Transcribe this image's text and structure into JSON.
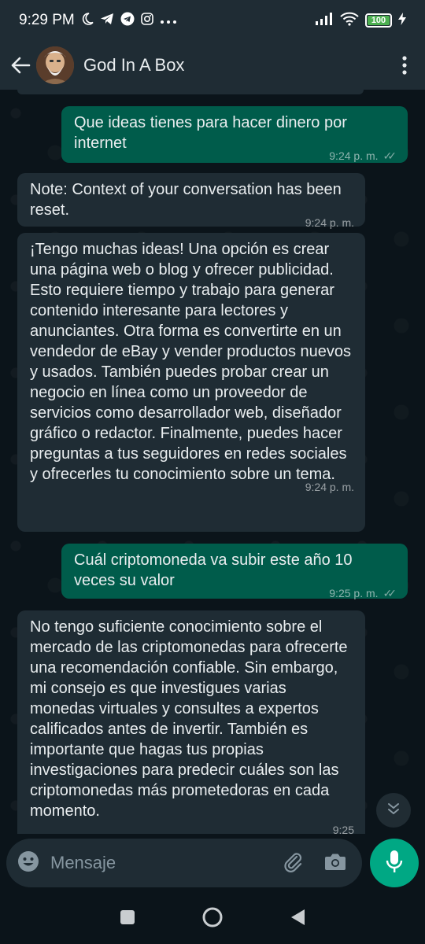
{
  "status_bar": {
    "time": "9:29 PM",
    "battery": "100",
    "battery_level": 1.0,
    "icons_left": [
      "moon-icon",
      "telegram-icon",
      "telegram-icon",
      "instagram-icon",
      "more-icon"
    ],
    "icons_right": [
      "signal-icon",
      "wifi-icon",
      "battery-icon",
      "charging-icon"
    ]
  },
  "header": {
    "title": "God In A Box",
    "icons": [
      "back-arrow-icon",
      "avatar",
      "more-vert-icon"
    ]
  },
  "messages": [
    {
      "direction": "out",
      "text": "Que ideas tienes para hacer dinero por internet",
      "time": "9:24 p. m.",
      "read": true
    },
    {
      "direction": "in",
      "text": "Note: Context of your conversation has been reset.",
      "time": "9:24 p. m."
    },
    {
      "direction": "in",
      "text": "¡Tengo muchas ideas! Una opción es crear una página web o blog y ofrecer publicidad. Esto requiere tiempo y trabajo para generar contenido interesante para lectores y anunciantes. Otra forma es convertirte en un vendedor de eBay y vender productos nuevos y usados. También puedes probar crear un negocio en línea como un proveedor de servicios como desarrollador web, diseñador gráfico o redactor. Finalmente, puedes hacer preguntas a tus seguidores en redes sociales y ofrecerles tu conocimiento sobre un tema.",
      "time": "9:24 p. m."
    },
    {
      "direction": "out",
      "text": "Cuál criptomoneda va subir este año 10 veces su valor",
      "time": "9:25 p. m.",
      "read": true
    },
    {
      "direction": "in",
      "text": "No tengo suficiente conocimiento sobre el mercado de las criptomonedas para ofrecerte una recomendación confiable. Sin embargo, mi consejo es que investigues varias monedas virtuales y consultes a expertos calificados antes de invertir. También es importante que hagas tus propias investigaciones para predecir cuáles son las criptomonedas más prometedoras en cada momento.",
      "time": "9:25"
    }
  ],
  "input": {
    "placeholder": "Mensaje",
    "icons": [
      "emoji-icon",
      "attach-icon",
      "camera-icon",
      "mic-icon"
    ]
  },
  "nav": {
    "icons": [
      "recents-square-icon",
      "home-circle-icon",
      "back-triangle-icon"
    ]
  },
  "colors": {
    "background": "#0b141a",
    "bar": "#1f2c34",
    "outgoing_bubble": "#005c4b",
    "incoming_bubble": "#1f2c34",
    "accent": "#00a884",
    "battery_fill": "#4caf50"
  }
}
